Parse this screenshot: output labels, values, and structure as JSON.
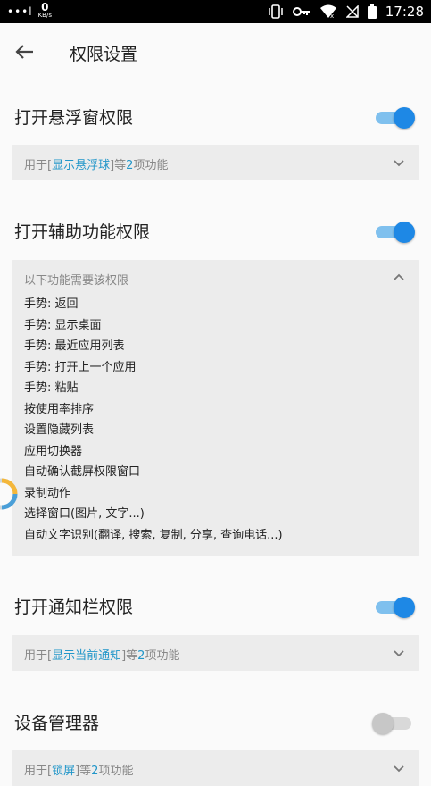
{
  "status_bar": {
    "signal": "•••l",
    "speed_value": "0",
    "speed_unit": "KB/s",
    "time": "17:28"
  },
  "header": {
    "title": "权限设置"
  },
  "sections": [
    {
      "title": "打开悬浮窗权限",
      "toggle_on": true,
      "panel": {
        "prefix": "用于[",
        "link": "显示悬浮球",
        "mid": "]等",
        "count": "2",
        "suffix": "项功能"
      }
    },
    {
      "title": "打开辅助功能权限",
      "toggle_on": true,
      "panel": {
        "header": "以下功能需要该权限",
        "items": [
          "手势: 返回",
          "手势: 显示桌面",
          "手势: 最近应用列表",
          "手势: 打开上一个应用",
          "手势: 粘贴",
          "按使用率排序",
          "设置隐藏列表",
          "应用切换器",
          "自动确认截屏权限窗口",
          "录制动作",
          "选择窗口(图片, 文字...)",
          "自动文字识别(翻译, 搜索, 复制, 分享, 查询电话...)"
        ]
      }
    },
    {
      "title": "打开通知栏权限",
      "toggle_on": true,
      "panel": {
        "prefix": "用于[",
        "link": "显示当前通知",
        "mid": "]等",
        "count": "2",
        "suffix": "项功能"
      }
    },
    {
      "title": "设备管理器",
      "toggle_on": false,
      "panel": {
        "prefix": "用于[",
        "link": "锁屏",
        "mid": "]等",
        "count": "2",
        "suffix": "项功能"
      }
    }
  ],
  "colors": {
    "accent": "#1e88e5",
    "link": "#2196c9"
  }
}
